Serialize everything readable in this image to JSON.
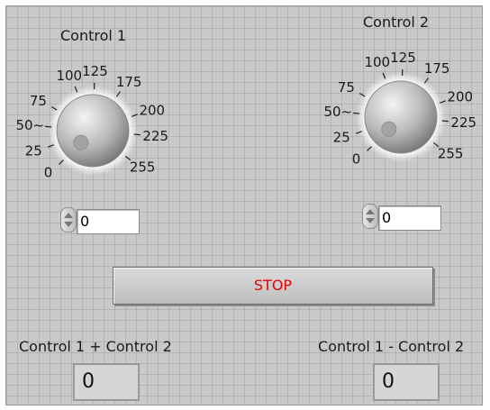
{
  "controls": [
    {
      "label": "Control 1",
      "value": "0",
      "scale": [
        "0",
        "25",
        "50~",
        "75",
        "100",
        "125",
        "175",
        "200",
        "225",
        "255"
      ]
    },
    {
      "label": "Control 2",
      "value": "0",
      "scale": [
        "0",
        "25",
        "50~",
        "75",
        "100",
        "125",
        "175",
        "200",
        "225",
        "255"
      ]
    }
  ],
  "stop_button": {
    "label": "STOP",
    "text_color": "#e60000"
  },
  "indicators": [
    {
      "label": "Control 1 + Control 2",
      "value": "0"
    },
    {
      "label": "Control 1 - Control 2",
      "value": "0"
    }
  ],
  "colors": {
    "panel_bg": "#c9c9c9",
    "grid": "#8c8c8c"
  }
}
